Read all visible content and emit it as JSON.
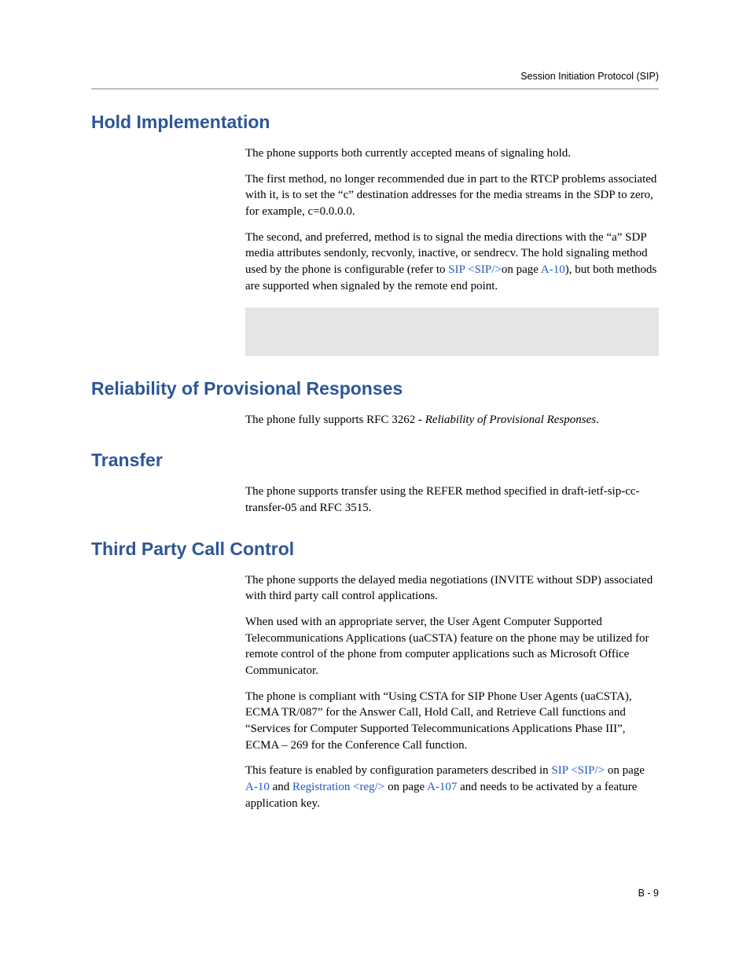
{
  "header": {
    "running_title": "Session Initiation Protocol (SIP)"
  },
  "sections": {
    "hold": {
      "heading": "Hold Implementation",
      "p1": "The phone supports both currently accepted means of signaling hold.",
      "p2": "The first method, no longer recommended due in part to the RTCP problems associated with it, is to set the “c” destination addresses for the media streams in the SDP to zero, for example, c=0.0.0.0.",
      "p3_a": "The second, and preferred, method is to signal the media directions with the “a” SDP media attributes sendonly, recvonly, inactive, or sendrecv. The hold signaling method used by the phone is configurable (refer to ",
      "p3_link": "SIP <SIP/>",
      "p3_b": "on page ",
      "p3_page": "A-10",
      "p3_c": "), but both methods are supported when signaled by the remote end point."
    },
    "reliability": {
      "heading": "Reliability of Provisional Responses",
      "p1_a": "The phone fully supports RFC 3262 - ",
      "p1_i": "Reliability of Provisional Responses",
      "p1_b": "."
    },
    "transfer": {
      "heading": "Transfer",
      "p1": "The phone supports transfer using the REFER method specified in draft-ietf-sip-cc-transfer-05 and RFC 3515."
    },
    "tpcc": {
      "heading": "Third Party Call Control",
      "p1": "The phone supports the delayed media negotiations (INVITE without SDP) associated with third party call control applications.",
      "p2": "When used with an appropriate server, the User Agent Computer Supported Telecommunications Applications (uaCSTA) feature on the phone may be utilized for remote control of the phone from computer applications such as Microsoft Office Communicator.",
      "p3": "The phone is compliant with “Using CSTA for SIP Phone User Agents (uaCSTA), ECMA TR/087” for the Answer Call, Hold Call, and Retrieve Call functions and “Services for Computer Supported Telecommunications Applications Phase III”, ECMA – 269 for the Conference Call function.",
      "p4_a": "This feature is enabled by configuration parameters described in ",
      "p4_link1": "SIP <SIP/>",
      "p4_b": " on page ",
      "p4_page1": "A-10",
      "p4_c": " and ",
      "p4_link2": "Registration <reg/>",
      "p4_d": " on page ",
      "p4_page2": "A-107",
      "p4_e": " and needs to be activated by a feature application key."
    }
  },
  "footer": {
    "page_number": "B - 9"
  }
}
